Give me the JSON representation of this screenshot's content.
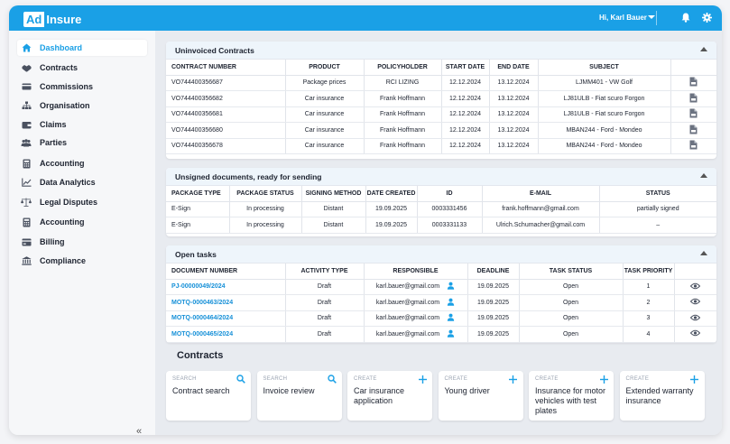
{
  "header": {
    "logo_ad": "Ad",
    "logo_insure": "Insure",
    "user_greeting": "Hi, Karl Bauer"
  },
  "colors": {
    "accent": "#1aa0e6",
    "link": "#1690d8"
  },
  "sidebar": {
    "items": [
      {
        "label": "Dashboard",
        "icon": "home-icon",
        "active": true
      },
      {
        "label": "Contracts",
        "icon": "hands-icon"
      },
      {
        "label": "Commissions",
        "icon": "card-icon"
      },
      {
        "label": "Organisation",
        "icon": "org-chart-icon"
      },
      {
        "label": "Claims",
        "icon": "wallet-icon"
      },
      {
        "label": "Parties",
        "icon": "people-icon"
      },
      {
        "label": "Accounting",
        "icon": "calculator-icon"
      },
      {
        "label": "Data Analytics",
        "icon": "chart-icon"
      },
      {
        "label": "Legal Disputes",
        "icon": "scales-icon"
      },
      {
        "label": "Accounting",
        "icon": "calculator-icon"
      },
      {
        "label": "Billing",
        "icon": "billing-icon"
      },
      {
        "label": "Compliance",
        "icon": "bank-icon"
      }
    ],
    "collapse_glyph": "«"
  },
  "uninvoiced": {
    "title": "Uninvoiced Contracts",
    "headers": [
      "CONTRACT NUMBER",
      "PRODUCT",
      "POLICYHOLDER",
      "START DATE",
      "END DATE",
      "SUBJECT"
    ],
    "rows": [
      [
        "VO744400356687",
        "Package prices",
        "RCI LIZING",
        "12.12.2024",
        "13.12.2024",
        "LJMM401 -  VW Golf"
      ],
      [
        "VO744400356682",
        "Car insurance",
        "Frank Hoffmann",
        "12.12.2024",
        "13.12.2024",
        "LJ81ULB - Fiat scuro Forgon"
      ],
      [
        "VO744400356681",
        "Car insurance",
        "Frank Hoffmann",
        "12.12.2024",
        "13.12.2024",
        "LJ81ULB - Fiat scuro Forgon"
      ],
      [
        "VO744400356680",
        "Car insurance",
        "Frank Hoffmann",
        "12.12.2024",
        "13.12.2024",
        "MBAN244 - Ford - Mondeo"
      ],
      [
        "VO744400356678",
        "Car insurance",
        "Frank Hoffmann",
        "12.12.2024",
        "13.12.2024",
        "MBAN244 - Ford - Mondeo"
      ]
    ]
  },
  "unsigned": {
    "title": "Unsigned documents, ready for sending",
    "headers": [
      "PACKAGE TYPE",
      "PACKAGE STATUS",
      "SIGNING METHOD",
      "DATE CREATED",
      "ID",
      "E-MAIL",
      "STATUS"
    ],
    "rows": [
      [
        "E-Sign",
        "In processing",
        "Distant",
        "19.09.2025",
        "0003331456",
        "frank.hoffmann@gmail.com",
        "partially signed"
      ],
      [
        "E-Sign",
        "In processing",
        "Distant",
        "19.09.2025",
        "0003331133",
        "Ulrich.Schumacher@gmail.com",
        "–"
      ]
    ]
  },
  "tasks": {
    "title": "Open tasks",
    "headers": [
      "DOCUMENT NUMBER",
      "ACTIVITY TYPE",
      "RESPONSIBLE",
      "DEADLINE",
      "TASK STATUS",
      "TASK PRIORITY"
    ],
    "rows": [
      [
        "PJ-00000049/2024",
        "Draft",
        "karl.bauer@gmail.com",
        "19.09.2025",
        "Open",
        "1"
      ],
      [
        "MOTQ-0000463/2024",
        "Draft",
        "karl.bauer@gmail.com",
        "19.09.2025",
        "Open",
        "2"
      ],
      [
        "MOTQ-0000464/2024",
        "Draft",
        "karl.bauer@gmail.com",
        "19.09.2025",
        "Open",
        "3"
      ],
      [
        "MOTQ-0000465/2024",
        "Draft",
        "karl.bauer@gmail.com",
        "19.09.2025",
        "Open",
        "4"
      ]
    ]
  },
  "contracts_section": {
    "title": "Contracts",
    "cards": [
      {
        "type": "SEARCH",
        "label": "Contract search",
        "icon": "search-icon"
      },
      {
        "type": "SEARCH",
        "label": "Invoice review",
        "icon": "search-icon"
      },
      {
        "type": "CREATE",
        "label": "Car insurance application",
        "icon": "plus-icon"
      },
      {
        "type": "CREATE",
        "label": "Young driver",
        "icon": "plus-icon"
      },
      {
        "type": "CREATE",
        "label": "Insurance for motor vehicles with test plates",
        "icon": "plus-icon"
      },
      {
        "type": "CREATE",
        "label": "Extended warranty insurance",
        "icon": "plus-icon"
      }
    ]
  }
}
